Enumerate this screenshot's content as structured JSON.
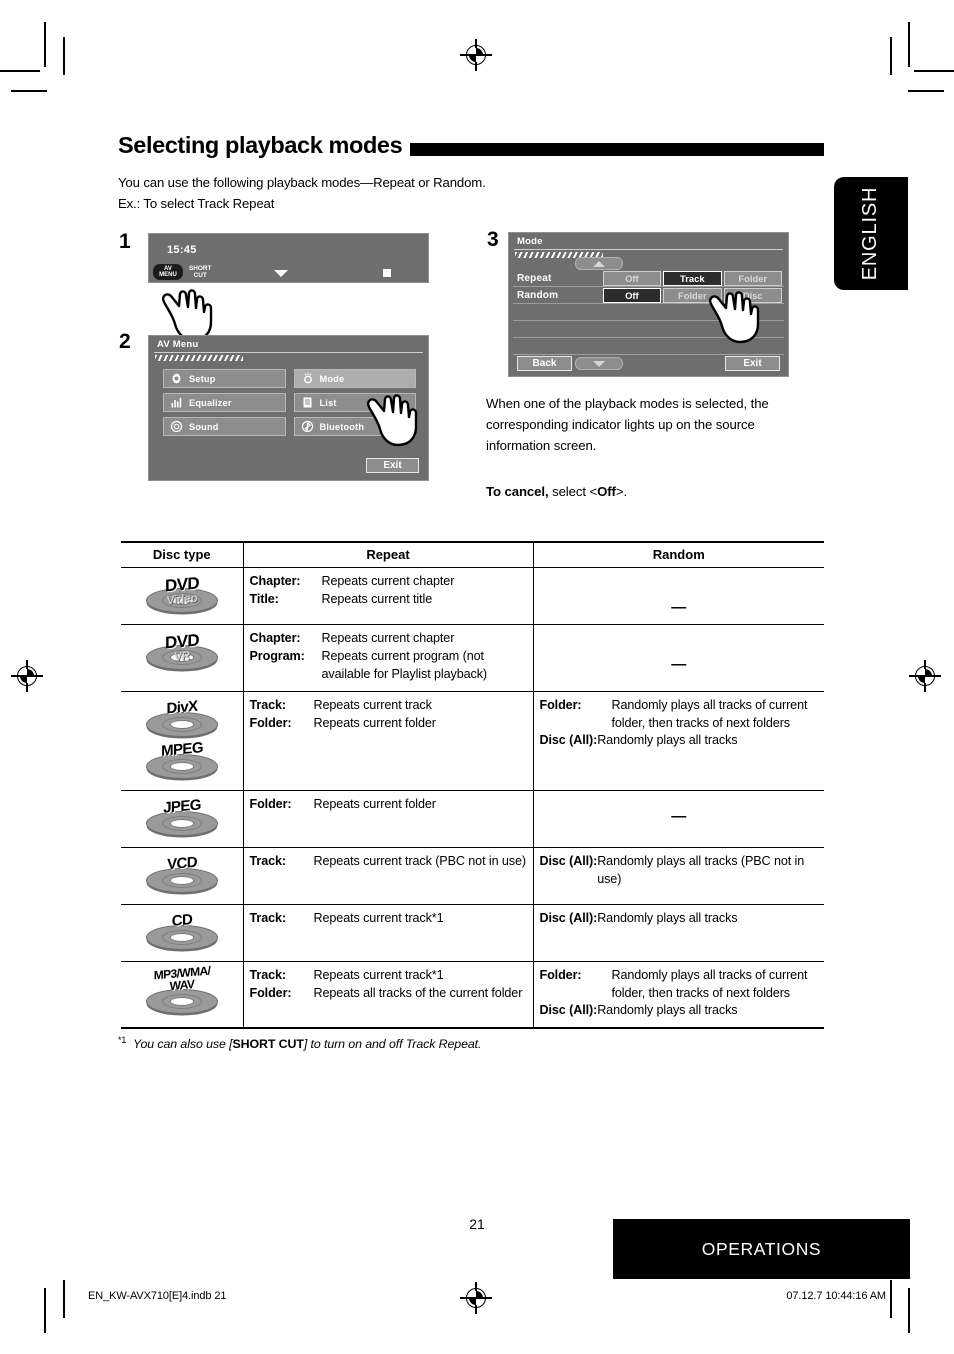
{
  "section": {
    "title": "Selecting playback modes",
    "intro_line1": "You can use the following playback modes—Repeat or Random.",
    "intro_line2": "Ex.: To select Track Repeat"
  },
  "language_tab": "ENGLISH",
  "steps": {
    "one": "1",
    "two": "2",
    "three": "3"
  },
  "screen1": {
    "time": "15:45",
    "av_menu_line1": "AV",
    "av_menu_line2": "MENU",
    "shortcut_line1": "SHORT",
    "shortcut_line2": "CUT"
  },
  "screen2": {
    "title": "AV Menu",
    "buttons": [
      {
        "label": "Setup",
        "icon": "gear-icon"
      },
      {
        "label": "Mode",
        "icon": "mode-sun-icon"
      },
      {
        "label": "Equalizer",
        "icon": "equalizer-icon"
      },
      {
        "label": "List",
        "icon": "list-icon"
      },
      {
        "label": "Sound",
        "icon": "sound-icon"
      },
      {
        "label": "Bluetooth",
        "icon": "bluetooth-icon"
      }
    ],
    "exit": "Exit"
  },
  "screen3": {
    "title": "Mode",
    "rows": [
      {
        "label": "Repeat",
        "options": [
          {
            "text": "Off",
            "selected": false
          },
          {
            "text": "Track",
            "selected": true
          },
          {
            "text": "Folder",
            "selected": false
          }
        ]
      },
      {
        "label": "Random",
        "options": [
          {
            "text": "Off",
            "selected": true
          },
          {
            "text": "Folder",
            "selected": false
          },
          {
            "text": "Disc",
            "selected": false
          }
        ]
      }
    ],
    "back": "Back",
    "exit": "Exit"
  },
  "right_column": {
    "note": "When one of the playback modes is selected, the corresponding indicator lights up on the source information screen.",
    "cancel_bold": "To cancel,",
    "cancel_rest": " select <",
    "cancel_off": "Off",
    "cancel_end": ">."
  },
  "table": {
    "headers": [
      "Disc type",
      "Repeat",
      "Random"
    ],
    "rows": [
      {
        "disc": {
          "label": "DVD",
          "sub": "Video",
          "style": "dvd"
        },
        "repeat": [
          {
            "key": "Chapter:",
            "value": "Repeats current chapter"
          },
          {
            "key": "Title:",
            "value": "Repeats current title"
          }
        ],
        "random_dash": "—",
        "random": []
      },
      {
        "disc": {
          "label": "DVD",
          "sub": "VR",
          "style": "dvd"
        },
        "repeat": [
          {
            "key": "Chapter:",
            "value": "Repeats current chapter"
          },
          {
            "key": "Program:",
            "value": "Repeats current program (not available for Playlist playback)"
          }
        ],
        "random_dash": "—",
        "random": []
      },
      {
        "disc": {
          "label": "DivX",
          "sub": "",
          "style": "plain"
        },
        "disc2": {
          "label": "MPEG",
          "sub": "",
          "style": "plain"
        },
        "repeat": [
          {
            "key": "Track:",
            "value": "Repeats current track"
          },
          {
            "key": "Folder:",
            "value": "Repeats current folder"
          }
        ],
        "random_dash": "",
        "random": [
          {
            "key": "Folder:",
            "value": "Randomly plays all tracks of current folder, then tracks of next folders"
          },
          {
            "key": "Disc (All):",
            "value": "Randomly plays all tracks"
          }
        ]
      },
      {
        "disc": {
          "label": "JPEG",
          "sub": "",
          "style": "plain"
        },
        "repeat": [
          {
            "key": "Folder:",
            "value": "Repeats current folder"
          }
        ],
        "random_dash": "—",
        "random": []
      },
      {
        "disc": {
          "label": "VCD",
          "sub": "",
          "style": "plain"
        },
        "repeat": [
          {
            "key": "Track:",
            "value": "Repeats current track (PBC not in use)"
          }
        ],
        "random_dash": "",
        "random": [
          {
            "key": "Disc (All):",
            "value": "Randomly plays all tracks (PBC not in use)"
          }
        ]
      },
      {
        "disc": {
          "label": "CD",
          "sub": "",
          "style": "plain"
        },
        "repeat": [
          {
            "key": "Track:",
            "value": "Repeats current track*1"
          }
        ],
        "random_dash": "",
        "random": [
          {
            "key": "Disc (All):",
            "value": "Randomly plays all tracks"
          }
        ]
      },
      {
        "disc": {
          "label": "MP3/WMA/\nWAV",
          "sub": "",
          "style": "mp3"
        },
        "repeat": [
          {
            "key": "Track:",
            "value": "Repeats current track*1"
          },
          {
            "key": "Folder:",
            "value": "Repeats all tracks of the current folder"
          }
        ],
        "random_dash": "",
        "random": [
          {
            "key": "Folder:",
            "value": "Randomly plays all tracks of current folder, then tracks of next folders"
          },
          {
            "key": "Disc (All):",
            "value": "Randomly plays all tracks"
          }
        ]
      }
    ]
  },
  "footnote": {
    "marker": "*1",
    "text_before": "You can also use  [",
    "bold": "SHORT CUT",
    "text_after": "] to turn on and off Track Repeat."
  },
  "page_footer": {
    "page_number": "21",
    "band_label": "OPERATIONS",
    "file_line": "EN_KW-AVX710[E]4.indb   21",
    "time_line": "07.12.7   10:44:16 AM"
  }
}
